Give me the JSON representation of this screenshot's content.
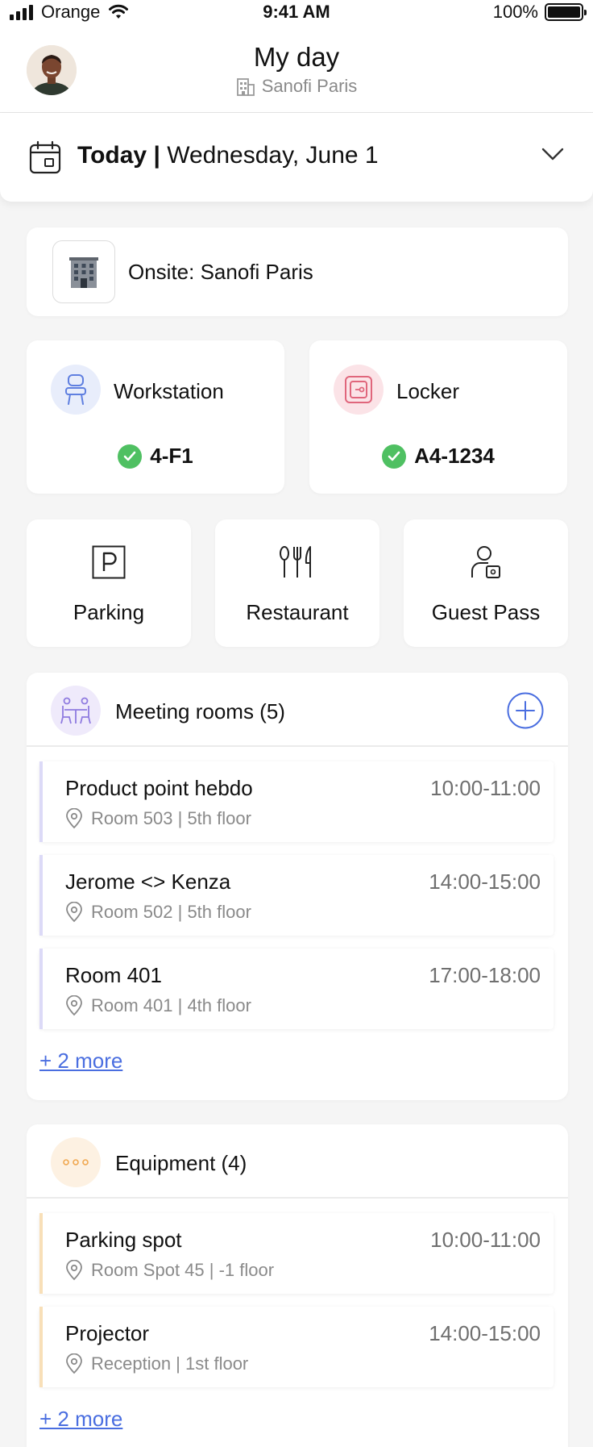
{
  "status_bar": {
    "carrier": "Orange",
    "time": "9:41 AM",
    "battery": "100%"
  },
  "header": {
    "title": "My day",
    "site": "Sanofi Paris"
  },
  "date": {
    "today_label": "Today |",
    "date_label": "Wednesday, June 1"
  },
  "onsite": {
    "label": "Onsite: Sanofi Paris"
  },
  "workstation": {
    "title": "Workstation",
    "value": "4-F1"
  },
  "locker": {
    "title": "Locker",
    "value": "A4-1234"
  },
  "services": {
    "parking": "Parking",
    "restaurant": "Restaurant",
    "guest_pass": "Guest Pass"
  },
  "meeting_rooms": {
    "title": "Meeting rooms (5)",
    "items": [
      {
        "title": "Product point hebdo",
        "time": "10:00-11:00",
        "location": "Room 503 | 5th floor"
      },
      {
        "title": "Jerome <> Kenza",
        "time": "14:00-15:00",
        "location": "Room 502 | 5th floor"
      },
      {
        "title": "Room 401",
        "time": "17:00-18:00",
        "location": "Room 401 | 4th floor"
      }
    ],
    "more": "+ 2 more"
  },
  "equipment": {
    "title": "Equipment (4)",
    "items": [
      {
        "title": "Parking spot",
        "time": "10:00-11:00",
        "location": "Room Spot 45 | -1 floor"
      },
      {
        "title": "Projector",
        "time": "14:00-15:00",
        "location": "Reception | 1st floor"
      }
    ],
    "more": "+ 2 more"
  },
  "colors": {
    "accent_blue": "#4a6ee0",
    "success_green": "#4fc062",
    "meeting_bar": "#dcdaf7",
    "equipment_bar": "#f8dfb8",
    "workstation_bg": "#e8edfb",
    "locker_bg": "#fbe3e7",
    "meeting_icon_bg": "#efeafb",
    "equipment_icon_bg": "#fdf1e2"
  }
}
